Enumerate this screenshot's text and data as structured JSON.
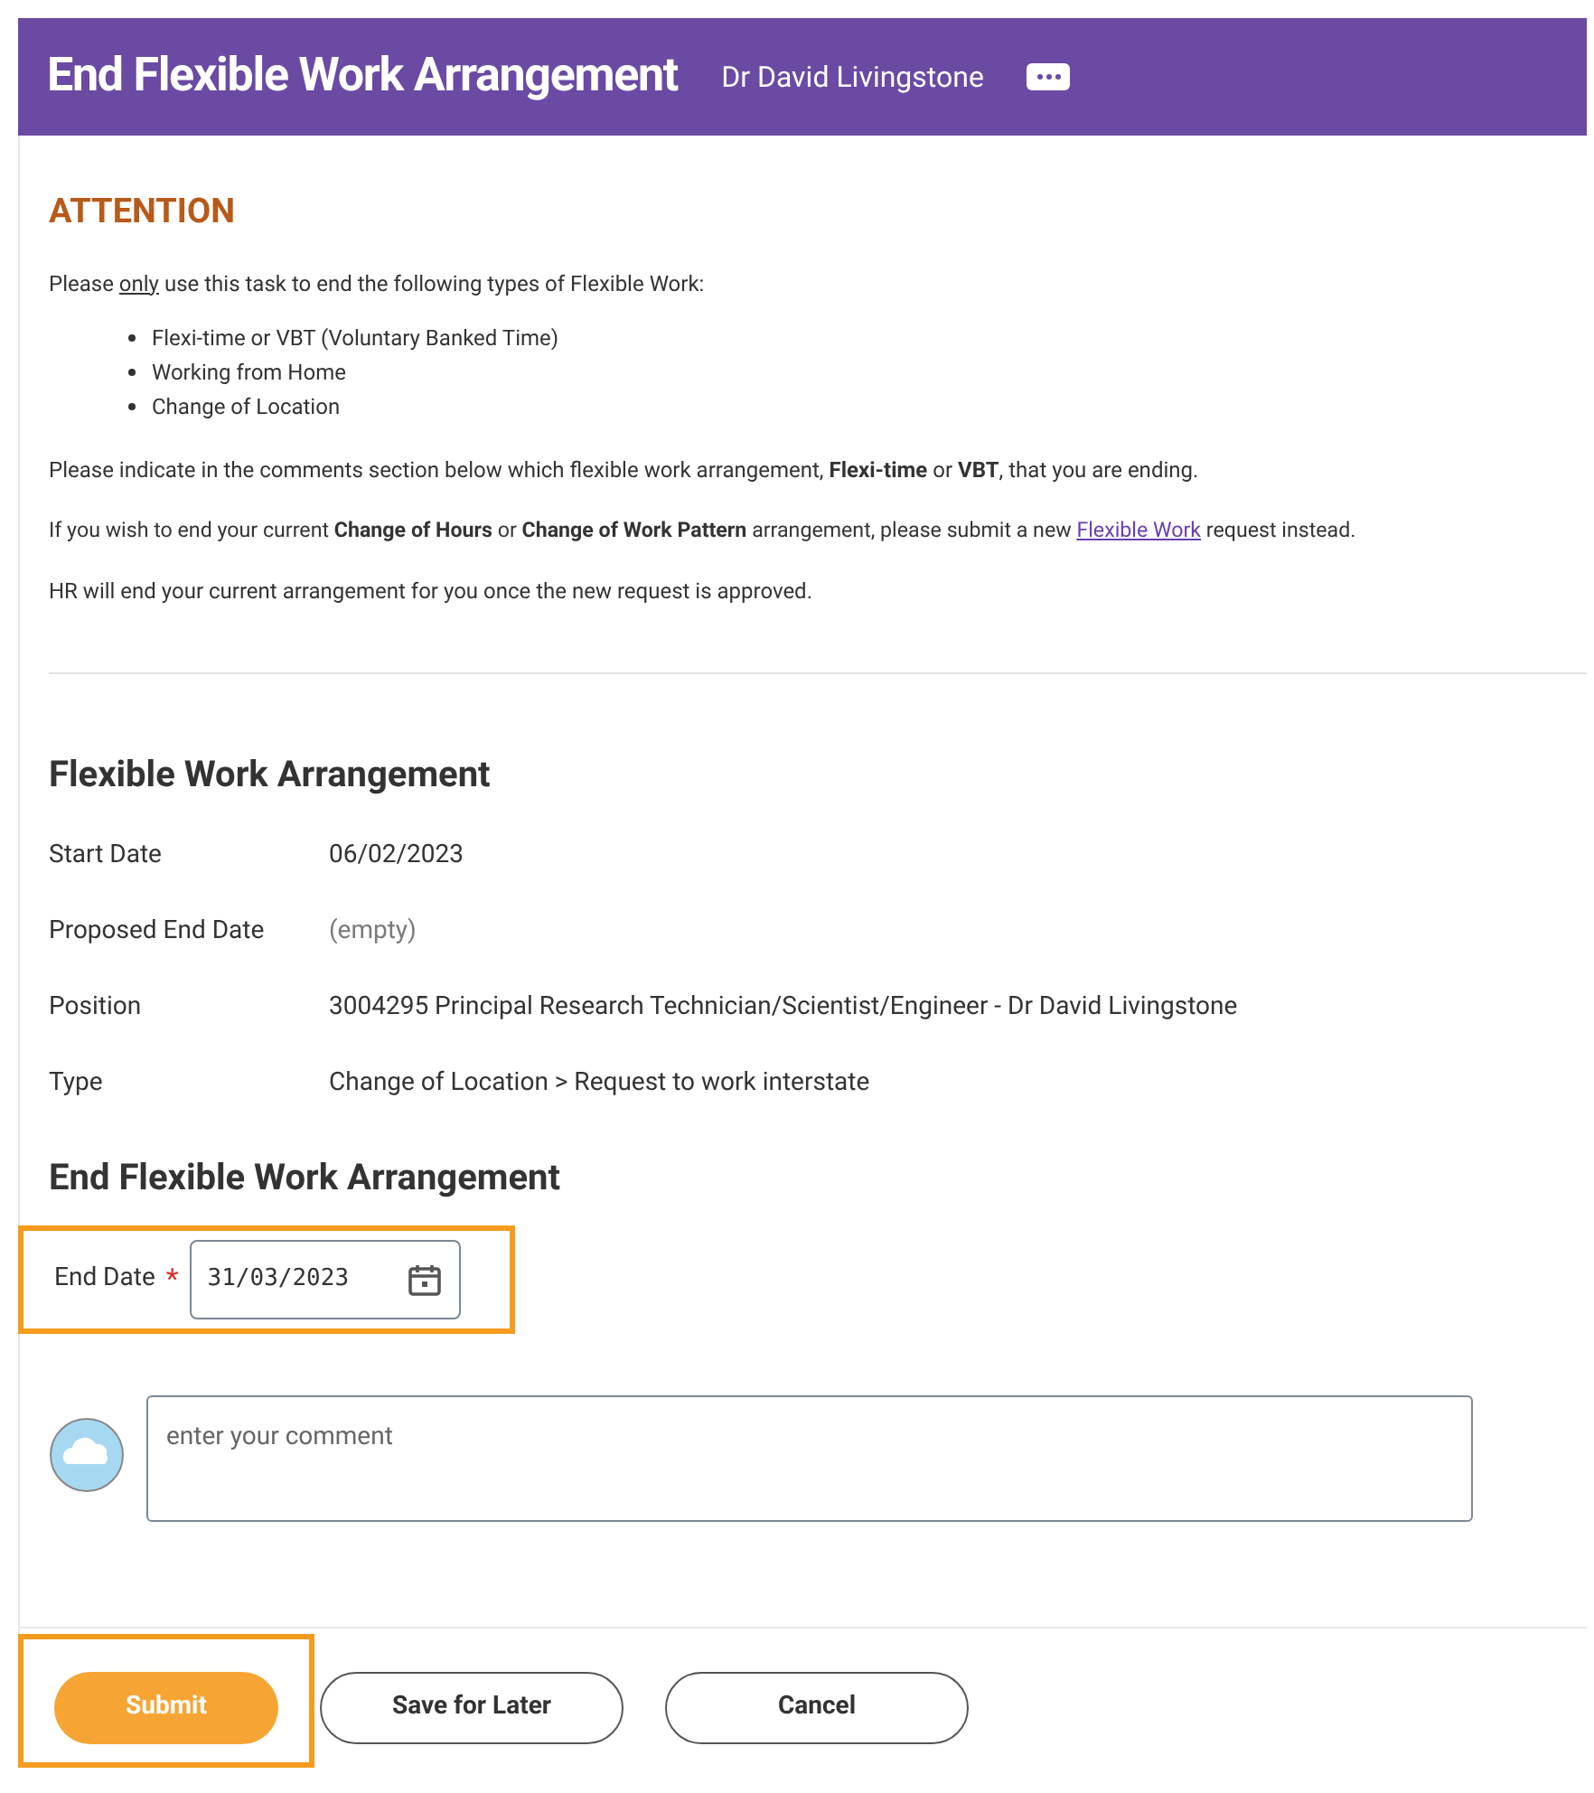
{
  "header": {
    "title": "End Flexible Work Arrangement",
    "worker": "Dr David Livingstone"
  },
  "attention": {
    "heading": "ATTENTION",
    "intro": {
      "before": "Please ",
      "underlined": "only",
      "after": " use this task to end the following types of Flexible Work:"
    },
    "bullets": [
      "Flexi-time or VBT (Voluntary Banked Time)",
      "Working from Home",
      "Change of Location"
    ],
    "indicate": "Please indicate in the comments section below which flexible work arrangement, **Flexi-time** or **VBT**, that you are ending.",
    "change": {
      "before": "If you wish to end your current **Change of Hours** or **Change of Work Pattern** arrangement, please submit a new ",
      "link": "Flexible Work",
      "after": " request instead."
    },
    "hr_note": "HR will end your current arrangement for you once the new request is approved."
  },
  "arrangement": {
    "heading": "Flexible Work Arrangement",
    "fields": [
      {
        "label": "Start Date",
        "value": "06/02/2023",
        "empty": false
      },
      {
        "label": "Proposed End Date",
        "value": "(empty)",
        "empty": true
      },
      {
        "label": "Position",
        "value": "3004295 Principal Research Technician/Scientist/Engineer - Dr David Livingstone",
        "empty": false
      },
      {
        "label": "Type",
        "value": "Change of Location > Request to work interstate",
        "empty": false
      }
    ]
  },
  "end_section": {
    "heading": "End Flexible Work Arrangement",
    "end_date": {
      "label": "End Date",
      "required_mark": "*",
      "value": "31/03/2023",
      "highlighted": true
    }
  },
  "comment": {
    "placeholder": "enter your comment"
  },
  "buttons": [
    {
      "label": "Submit",
      "kind": "primary",
      "highlighted": true
    },
    {
      "label": "Save for Later",
      "kind": "secondary",
      "highlighted": false
    },
    {
      "label": "Cancel",
      "kind": "secondary",
      "highlighted": false
    }
  ]
}
